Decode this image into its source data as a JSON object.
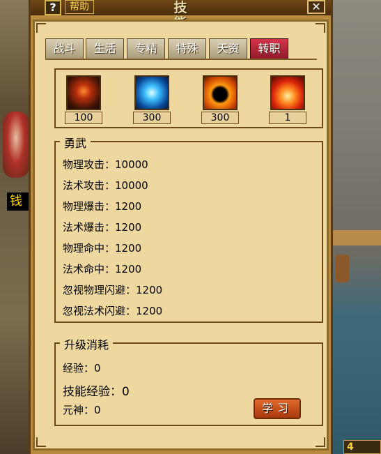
{
  "scene": {
    "character_name": "钱",
    "counter": "4"
  },
  "window": {
    "help_symbol": "?",
    "help_label": "帮助",
    "title": "技 能",
    "close_symbol": "✕"
  },
  "tabs": [
    {
      "label": "战斗",
      "active": false
    },
    {
      "label": "生活",
      "active": false
    },
    {
      "label": "专精",
      "active": false
    },
    {
      "label": "特殊",
      "active": false
    },
    {
      "label": "天资",
      "active": false
    },
    {
      "label": "转职",
      "active": true
    }
  ],
  "skills": [
    {
      "icon": "fire-warrior-icon",
      "value": "100"
    },
    {
      "icon": "ice-skull-icon",
      "value": "300"
    },
    {
      "icon": "dark-heart-icon",
      "value": "300"
    },
    {
      "icon": "flame-demon-icon",
      "value": "1"
    }
  ],
  "stats_section": {
    "title": "勇武",
    "rows": [
      {
        "label": "物理攻击：10000"
      },
      {
        "label": "法术攻击：10000"
      },
      {
        "label": "物理爆击：1200"
      },
      {
        "label": "法术爆击：1200"
      },
      {
        "label": "物理命中：1200"
      },
      {
        "label": "法术命中：1200"
      },
      {
        "label": "忽视物理闪避：1200"
      },
      {
        "label": "忽视法术闪避：1200"
      }
    ]
  },
  "upgrade_section": {
    "title": "升级消耗",
    "exp": "经验：0",
    "skill_exp": "技能经验：0",
    "spirit": "元神：0",
    "learn_button": "学习"
  }
}
